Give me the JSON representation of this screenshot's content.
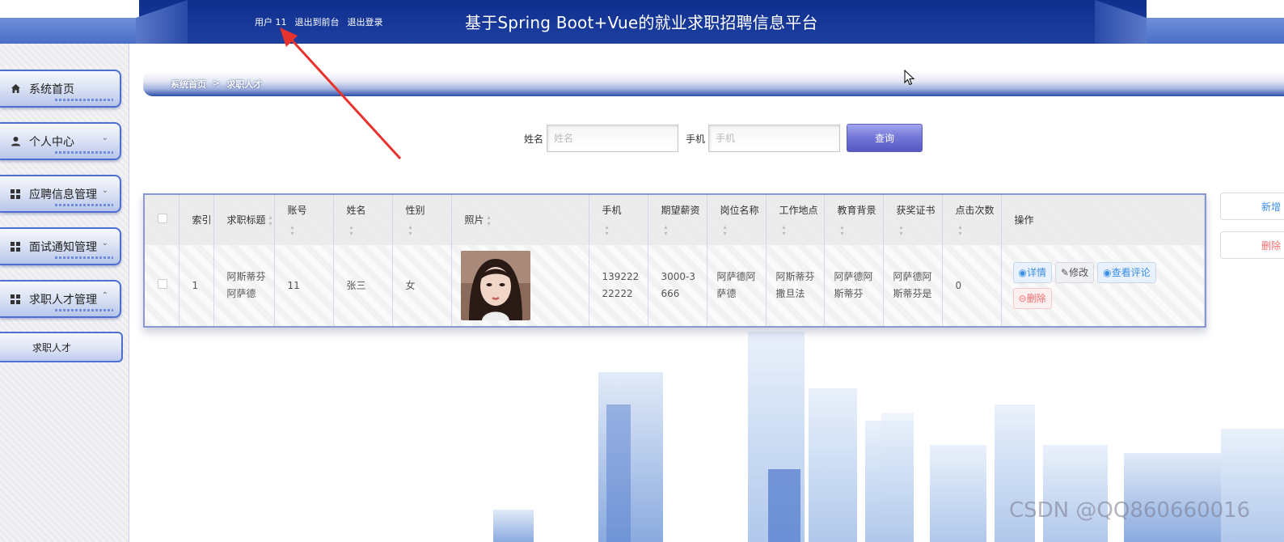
{
  "header": {
    "user_label": "用户 11",
    "to_frontend": "退出到前台",
    "logout": "退出登录",
    "title": "基于Spring Boot+Vue的就业求职招聘信息平台"
  },
  "sidebar": {
    "items": [
      {
        "label": "系统首页",
        "icon": "home-icon"
      },
      {
        "label": "个人中心",
        "icon": "person-icon",
        "caret": "down"
      },
      {
        "label": "应聘信息管理",
        "icon": "grid-icon",
        "caret": "down"
      },
      {
        "label": "面试通知管理",
        "icon": "grid-icon",
        "caret": "down"
      },
      {
        "label": "求职人才管理",
        "icon": "grid-icon",
        "caret": "up"
      }
    ],
    "submenu": [
      "求职人才"
    ]
  },
  "breadcrumb": {
    "home": "系统首页",
    "separator": ">",
    "current": "求职人才"
  },
  "search": {
    "name_label": "姓名",
    "name_placeholder": "姓名",
    "name_value": "",
    "phone_label": "手机",
    "phone_placeholder": "手机",
    "phone_value": "",
    "query_button": "查询"
  },
  "side_buttons": {
    "add": "新增",
    "delete": "删除"
  },
  "table": {
    "headers": [
      "索引",
      "求职标题",
      "账号",
      "姓名",
      "性别",
      "照片",
      "手机",
      "期望薪资",
      "岗位名称",
      "工作地点",
      "教育背景",
      "获奖证书",
      "点击次数",
      "操作"
    ],
    "rows": [
      {
        "index": "1",
        "title": "阿斯蒂芬阿萨德",
        "account": "11",
        "name": "张三",
        "gender": "女",
        "phone": "13922222222",
        "salary": "3000-3666",
        "position": "阿萨德阿萨德",
        "location": "阿斯蒂芬撒旦法",
        "education": "阿萨德阿斯蒂芬",
        "awards": "阿萨德阿斯蒂芬是",
        "clicks": "0",
        "actions": {
          "detail": "详情",
          "edit": "修改",
          "comments": "查看评论",
          "delete": "删除"
        }
      }
    ]
  },
  "watermark": "CSDN @QQ860660016",
  "colors": {
    "header_bg": "#0f2f8e",
    "accent_border": "#4d6fd2",
    "query_button": "#7678d9",
    "danger": "#f56c6c",
    "link": "#3a8ee6"
  }
}
